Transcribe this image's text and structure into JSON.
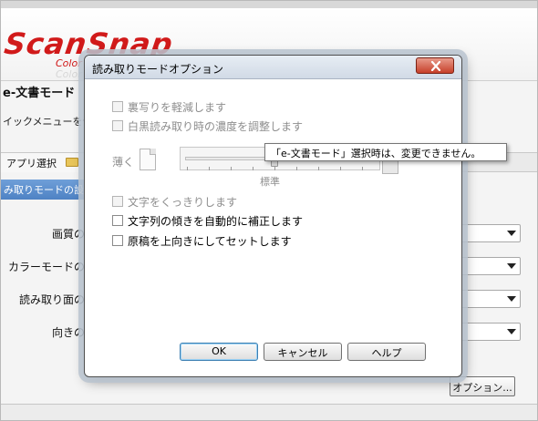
{
  "app": {
    "logo": "ScanSnap",
    "logo_sub": "Color Image Scanner",
    "logo_ghost": "Color Image",
    "mode_title": "e-文書モード",
    "quick_menu": "イックメニューを使",
    "tabs": {
      "app_select": "アプリ選択"
    },
    "section_title": "み取りモードの設",
    "settings": [
      {
        "label": "画質の"
      },
      {
        "label": "カラーモードの"
      },
      {
        "label": "読み取り面の"
      },
      {
        "label": "向きの"
      }
    ],
    "option_button": "オプション..."
  },
  "dialog": {
    "title": "読み取りモードオプション",
    "checkboxes": [
      {
        "label": "裏写りを軽減します",
        "checked": false,
        "enabled": false
      },
      {
        "label": "白黒読み取り時の濃度を調整します",
        "checked": false,
        "enabled": false
      },
      {
        "label": "文字をくっきりします",
        "checked": false,
        "enabled": false
      },
      {
        "label": "文字列の傾きを自動的に補正します",
        "checked": false,
        "enabled": true
      },
      {
        "label": "原稿を上向きにしてセットします",
        "checked": false,
        "enabled": true
      }
    ],
    "density": {
      "light_label": "薄く",
      "standard_label": "標準",
      "level": 0.5
    },
    "buttons": {
      "ok": "OK",
      "cancel": "キャンセル",
      "help": "ヘルプ"
    }
  },
  "tooltip": "「e-文書モード」選択時は、変更できません。",
  "colors": {
    "logo": "#d11a1a",
    "section_bar": "#4e82c4",
    "close_button": "#c7402a"
  }
}
